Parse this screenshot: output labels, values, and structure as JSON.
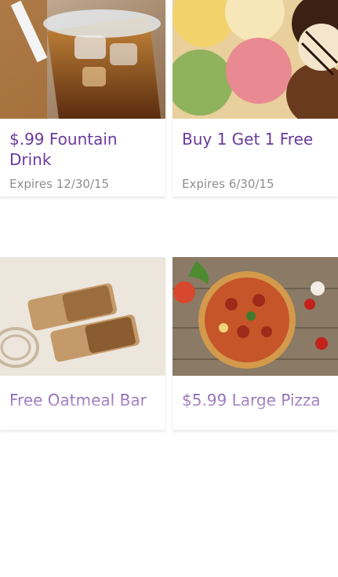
{
  "deals": [
    {
      "title": "$.99 Fountain Drink",
      "expires": "Expires 12/30/15",
      "image_icon": "fountain-drink-photo"
    },
    {
      "title": "Buy 1 Get 1 Free",
      "expires": "Expires 6/30/15",
      "image_icon": "ice-cream-photo"
    },
    {
      "title": "Free Oatmeal Bar",
      "expires": "",
      "image_icon": "oatmeal-bar-photo"
    },
    {
      "title": "$5.99 Large Pizza",
      "expires": "",
      "image_icon": "pizza-photo"
    }
  ],
  "colors": {
    "title": "#6b3a9e",
    "expires": "#8e8e8e",
    "background": "#ffffff"
  }
}
